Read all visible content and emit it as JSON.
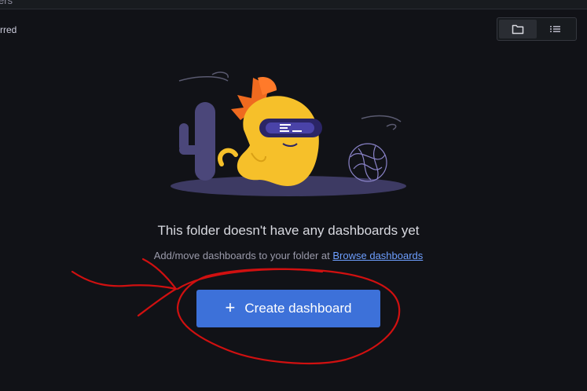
{
  "header": {
    "breadcrumb_fragment": "ers"
  },
  "filters": {
    "starred_label": "rred"
  },
  "view_toggle": {
    "options": [
      "folder-view",
      "list-view"
    ],
    "active": "folder-view"
  },
  "empty_state": {
    "title": "This folder doesn't have any dashboards yet",
    "subtitle": "Add/move dashboards to your folder at",
    "link_text": "Browse dashboards"
  },
  "actions": {
    "create_label": "Create dashboard",
    "create_icon": "plus-icon"
  },
  "colors": {
    "background": "#111217",
    "primary_button": "#3d71d9",
    "link": "#6e9fff",
    "annotation": "#d01010"
  }
}
